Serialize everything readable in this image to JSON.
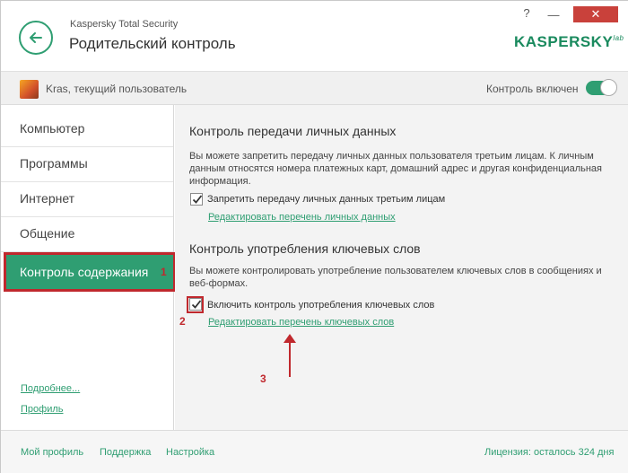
{
  "window": {
    "app_name": "Kaspersky Total Security",
    "title": "Родительский контроль",
    "help_glyph": "?",
    "minimize_glyph": "—",
    "close_glyph": "✕",
    "logo": "KASPERSKY",
    "logo_suffix": "lab"
  },
  "userbar": {
    "user_label": "Kras, текущий пользователь",
    "control_label": "Контроль включен",
    "control_enabled": true
  },
  "sidebar": {
    "items": [
      {
        "label": "Компьютер"
      },
      {
        "label": "Программы"
      },
      {
        "label": "Интернет"
      },
      {
        "label": "Общение"
      }
    ],
    "active_item": {
      "label": "Контроль содержания",
      "annotation": "1"
    },
    "links": {
      "more": "Подробнее...",
      "profile": "Профиль"
    }
  },
  "main": {
    "personal": {
      "title": "Контроль передачи личных данных",
      "desc": "Вы можете запретить передачу личных данных пользователя третьим лицам. К личным данным относятся номера платежных карт, домашний адрес и другая конфиденциальная информация.",
      "checkbox_label": "Запретить передачу личных данных третьим лицам",
      "checked": true,
      "link": "Редактировать перечень личных данных"
    },
    "keywords": {
      "title": "Контроль употребления ключевых слов",
      "desc": "Вы можете контролировать употребление пользователем ключевых слов в сообщениях и веб-формах.",
      "checkbox_label": "Включить контроль употребления ключевых слов",
      "checked": true,
      "link": "Редактировать перечень ключевых слов"
    },
    "annotations": {
      "checkbox": "2",
      "link": "3"
    },
    "annotation_color": "#c0282d"
  },
  "footer": {
    "links": [
      "Мой профиль",
      "Поддержка",
      "Настройка"
    ],
    "license": "Лицензия: осталось 324 дня"
  },
  "colors": {
    "accent": "#2f9e72",
    "annotation": "#c0282d"
  },
  "icons": {
    "back": "arrow-left-icon",
    "check": "checkmark-icon",
    "arrow": "arrow-up-icon"
  }
}
